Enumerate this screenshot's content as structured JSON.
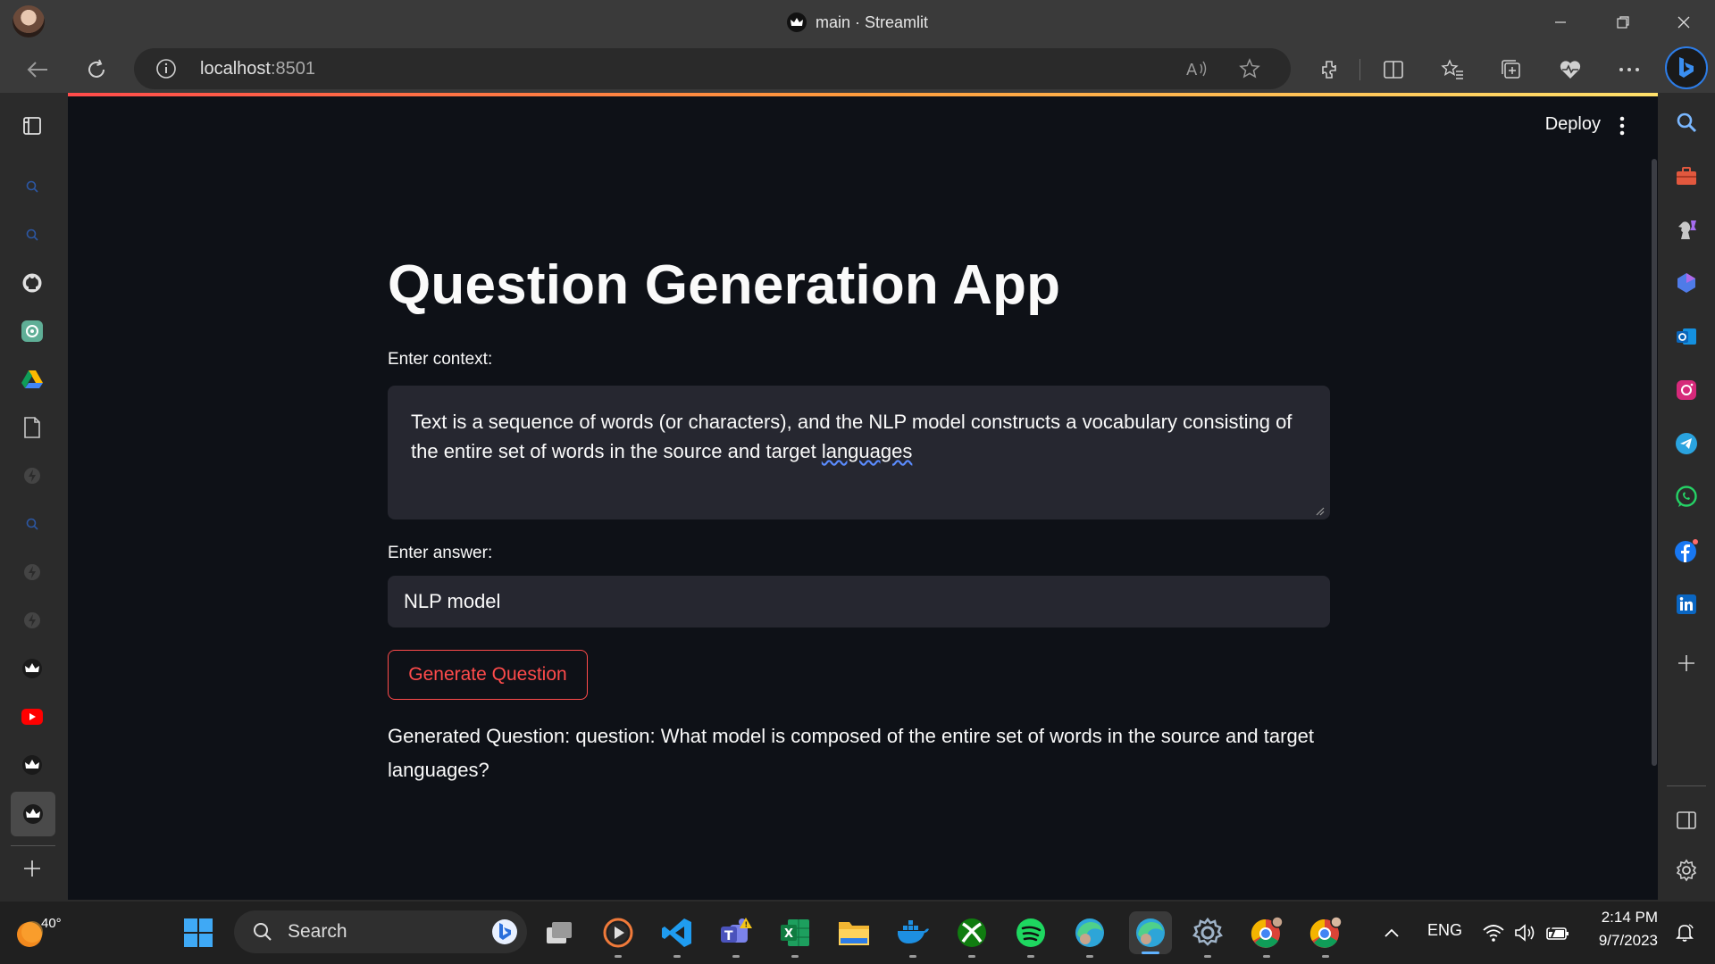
{
  "browser": {
    "window_title": "main · Streamlit",
    "url_host": "localhost",
    "url_port": ":8501"
  },
  "app": {
    "deploy_label": "Deploy",
    "title": "Question Generation App",
    "context_label": "Enter context:",
    "context_value_part1": "Text is a sequence of words (or characters), and the NLP model constructs a vocabulary consisting of the entire set of words in the source and target ",
    "context_value_part2": "languages",
    "answer_label": "Enter answer:",
    "answer_value": "NLP model",
    "button_label": "Generate Question",
    "generated_question": "Generated Question: question: What model is composed of the entire set of words in the source and target languages?"
  },
  "taskbar": {
    "weather_temp": "40°",
    "search_placeholder": "Search",
    "language": "ENG",
    "time": "2:14 PM",
    "date": "9/7/2023"
  },
  "colors": {
    "app_bg": "#0e1117",
    "input_bg": "#262730",
    "accent": "#ff4b4b"
  }
}
